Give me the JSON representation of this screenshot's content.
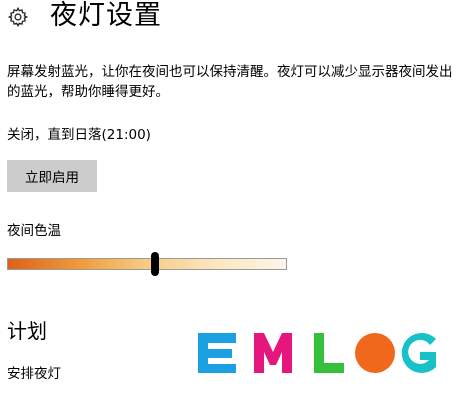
{
  "header": {
    "icon": "gear-icon",
    "title": "夜灯设置"
  },
  "description": "屏幕发射蓝光，让你在夜间也可以保持清醒。夜灯可以减少显示器夜间发出的蓝光，帮助你睡得更好。",
  "status": "关闭，直到日落(21:00)",
  "enable_button": "立即启用",
  "color_temperature": {
    "label": "夜间色温",
    "value": 0.53
  },
  "schedule": {
    "title": "计划",
    "label": "安排夜灯"
  },
  "watermark": {
    "text": "EMLOG",
    "colors": [
      "#1ba0e1",
      "#e5177e",
      "#34c03a",
      "#f0681c",
      "#18c1c8"
    ]
  }
}
